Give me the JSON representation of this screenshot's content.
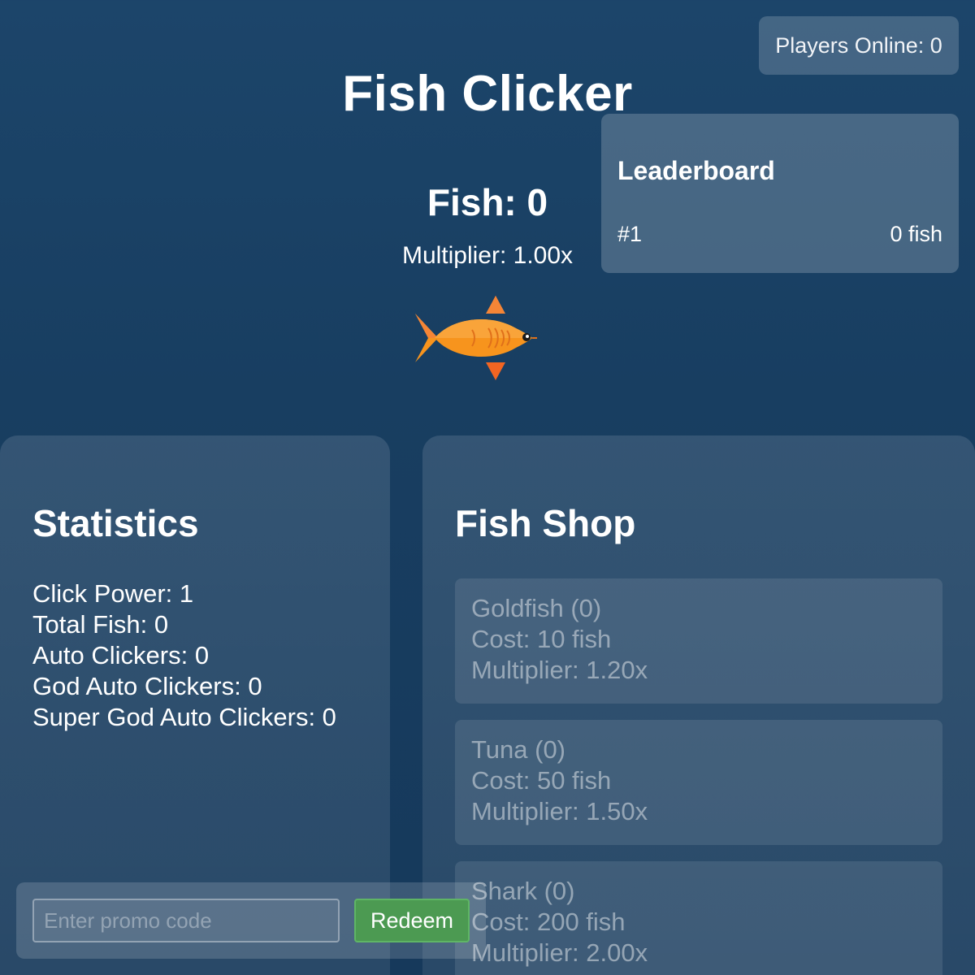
{
  "header": {
    "players_online": "Players Online: 0",
    "title": "Fish Clicker"
  },
  "leaderboard": {
    "title": "Leaderboard",
    "entries": [
      {
        "rank": "#1",
        "score": "0 fish"
      }
    ]
  },
  "game": {
    "fish_count": "Fish: 0",
    "multiplier": "Multiplier: 1.00x",
    "fish_icon": "fish-icon",
    "fish_color": "#f7941d",
    "arrow_color": "#f26522"
  },
  "statistics": {
    "title": "Statistics",
    "items": [
      "Click Power: 1",
      "Total Fish: 0",
      "Auto Clickers: 0",
      "God Auto Clickers: 0",
      "Super God Auto Clickers: 0"
    ]
  },
  "shop": {
    "title": "Fish Shop",
    "items": [
      {
        "name": "Goldfish (0)",
        "cost": "Cost: 10 fish",
        "multiplier": "Multiplier: 1.20x"
      },
      {
        "name": "Tuna (0)",
        "cost": "Cost: 50 fish",
        "multiplier": "Multiplier: 1.50x"
      },
      {
        "name": "Shark (0)",
        "cost": "Cost: 200 fish",
        "multiplier": "Multiplier: 2.00x"
      }
    ]
  },
  "promo": {
    "placeholder": "Enter promo code",
    "value": "",
    "button_label": "Redeem",
    "button_color": "#4c9a52"
  }
}
